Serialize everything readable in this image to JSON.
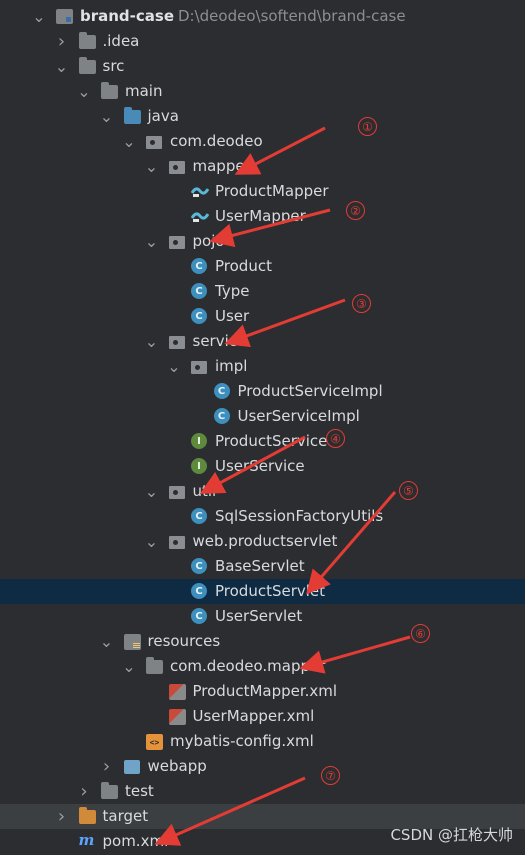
{
  "project": {
    "name": "brand-case",
    "path": "D:\\deodeo\\softend\\brand-case"
  },
  "tree": [
    {
      "label": "brand-case",
      "extra": "D:\\deodeo\\softend\\brand-case",
      "arrow": "down",
      "icon": "module-folder-icon",
      "level": 0,
      "bold": true
    },
    {
      "label": ".idea",
      "arrow": "right",
      "icon": "folder-icon",
      "level": 1
    },
    {
      "label": "src",
      "arrow": "down",
      "icon": "folder-icon",
      "level": 1
    },
    {
      "label": "main",
      "arrow": "down",
      "icon": "folder-icon",
      "level": 2
    },
    {
      "label": "java",
      "arrow": "down",
      "icon": "source-folder-icon",
      "level": 3
    },
    {
      "label": "com.deodeo",
      "arrow": "down",
      "icon": "package-icon",
      "level": 4
    },
    {
      "label": "mapper",
      "arrow": "down",
      "icon": "package-icon",
      "level": 5
    },
    {
      "label": "ProductMapper",
      "icon": "mapper-interface-icon",
      "level": 6
    },
    {
      "label": "UserMapper",
      "icon": "mapper-interface-icon",
      "level": 6
    },
    {
      "label": "pojo",
      "arrow": "down",
      "icon": "package-icon",
      "level": 5
    },
    {
      "label": "Product",
      "icon": "class-icon",
      "level": 6
    },
    {
      "label": "Type",
      "icon": "class-icon",
      "level": 6
    },
    {
      "label": "User",
      "icon": "class-icon",
      "level": 6
    },
    {
      "label": "service",
      "arrow": "down",
      "icon": "package-icon",
      "level": 5
    },
    {
      "label": "impl",
      "arrow": "down",
      "icon": "package-icon",
      "level": 6
    },
    {
      "label": "ProductServiceImpl",
      "icon": "class-icon",
      "level": 7
    },
    {
      "label": "UserServiceImpl",
      "icon": "class-icon",
      "level": 7
    },
    {
      "label": "ProductService",
      "icon": "interface-icon",
      "level": 6
    },
    {
      "label": "UserService",
      "icon": "interface-icon",
      "level": 6
    },
    {
      "label": "util",
      "arrow": "down",
      "icon": "package-icon",
      "level": 5
    },
    {
      "label": "SqlSessionFactoryUtils",
      "icon": "class-icon",
      "level": 6
    },
    {
      "label": "web.productservlet",
      "arrow": "down",
      "icon": "package-icon",
      "level": 5
    },
    {
      "label": "BaseServlet",
      "icon": "class-icon",
      "level": 6
    },
    {
      "label": "ProductServlet",
      "icon": "class-icon",
      "level": 6,
      "selected": true
    },
    {
      "label": "UserServlet",
      "icon": "class-icon",
      "level": 6
    },
    {
      "label": "resources",
      "arrow": "down",
      "icon": "resources-folder-icon",
      "level": 3
    },
    {
      "label": "com.deodeo.mapper",
      "arrow": "down",
      "icon": "folder-icon",
      "level": 4
    },
    {
      "label": "ProductMapper.xml",
      "icon": "mybatis-xml-icon",
      "level": 5
    },
    {
      "label": "UserMapper.xml",
      "icon": "mybatis-xml-icon",
      "level": 5
    },
    {
      "label": "mybatis-config.xml",
      "icon": "config-xml-icon",
      "level": 4
    },
    {
      "label": "webapp",
      "arrow": "right",
      "icon": "web-folder-icon",
      "level": 3
    },
    {
      "label": "test",
      "arrow": "right",
      "icon": "folder-icon",
      "level": 2
    },
    {
      "label": "target",
      "arrow": "right",
      "icon": "excluded-folder-icon",
      "level": 1,
      "tail": true
    },
    {
      "label": "pom.xml",
      "icon": "maven-icon",
      "level": 1
    }
  ],
  "annotations": [
    "①",
    "②",
    "③",
    "④",
    "⑤",
    "⑥",
    "⑦"
  ],
  "colors": {
    "background": "#2b2d30",
    "selection": "#0f2b44",
    "annotation": "#e23c35",
    "class": "#3d8fbd",
    "interface": "#5d8a3d"
  },
  "watermark": "CSDN @扛枪大帅"
}
